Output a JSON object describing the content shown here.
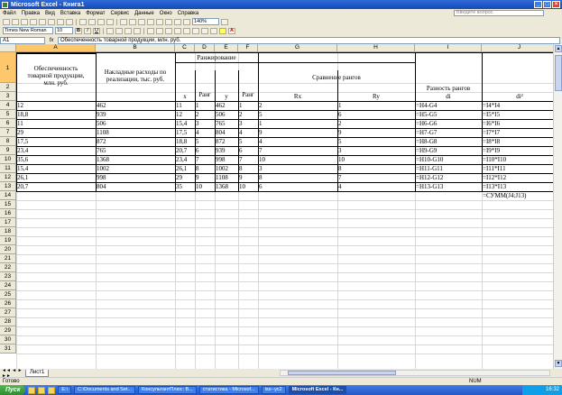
{
  "window": {
    "title": "Microsoft Excel - Книга1"
  },
  "menu": {
    "items": [
      "Файл",
      "Правка",
      "Вид",
      "Вставка",
      "Формат",
      "Сервис",
      "Данные",
      "Окно",
      "Справка"
    ],
    "help_placeholder": "Введите вопрос"
  },
  "toolbar": {
    "zoom": "140%",
    "font_name": "Times New Roman",
    "font_size": "10"
  },
  "formula_bar": {
    "name_box": "A1",
    "fx": "fx",
    "content": "Обеспеченность товарной продукции, млн. руб."
  },
  "grid": {
    "columns": [
      "A",
      "B",
      "C",
      "D",
      "E",
      "F",
      "G",
      "H",
      "I",
      "J"
    ],
    "rows": [
      1,
      2,
      3,
      4,
      5,
      6,
      7,
      8,
      9,
      10,
      11,
      12,
      13,
      14,
      15,
      16,
      17,
      18,
      19,
      20,
      21,
      22,
      23,
      24,
      25,
      26,
      27,
      28,
      29,
      30,
      31
    ],
    "headers": {
      "a": "Обеспеченность товарной продукции, млн. руб.",
      "b": "Накладные расходы по реализации, тыс. руб.",
      "ranking": "Ранжирование",
      "x": "x",
      "rank_x": "Ранг",
      "y": "y",
      "rank_y": "Ранг",
      "compare": "Сравнение рангов",
      "rx": "Rx",
      "ry": "Ry",
      "diff": "Разность рангов",
      "di": "di",
      "di2": "di²"
    },
    "data": [
      [
        "12",
        "462",
        "11",
        "1",
        "462",
        "1",
        "2",
        "1",
        "=H4-G4",
        "=I4*I4"
      ],
      [
        "18,8",
        "939",
        "12",
        "2",
        "506",
        "2",
        "5",
        "6",
        "=H5-G5",
        "=I5*I5"
      ],
      [
        "11",
        "506",
        "15,4",
        "3",
        "765",
        "3",
        "1",
        "2",
        "=H6-G6",
        "=I6*I6"
      ],
      [
        "29",
        "1108",
        "17,5",
        "4",
        "804",
        "4",
        "9",
        "9",
        "=H7-G7",
        "=I7*I7"
      ],
      [
        "17,5",
        "872",
        "18,8",
        "5",
        "872",
        "5",
        "4",
        "5",
        "=H8-G8",
        "=I8*I8"
      ],
      [
        "23,4",
        "765",
        "20,7",
        "6",
        "939",
        "6",
        "7",
        "3",
        "=H9-G9",
        "=I9*I9"
      ],
      [
        "35,6",
        "1368",
        "23,4",
        "7",
        "998",
        "7",
        "10",
        "10",
        "=H10-G10",
        "=I10*I10"
      ],
      [
        "15,4",
        "1002",
        "26,1",
        "8",
        "1002",
        "8",
        "3",
        "8",
        "=H11-G11",
        "=I11*I11"
      ],
      [
        "26,1",
        "998",
        "29",
        "9",
        "1108",
        "9",
        "8",
        "7",
        "=H12-G12",
        "=I12*I12"
      ],
      [
        "20,7",
        "804",
        "35",
        "10",
        "1368",
        "10",
        "6",
        "4",
        "=H13-G13",
        "=I13*I13"
      ]
    ],
    "sum_formula": "=СУММ(J4:J13)"
  },
  "sheet_tab": "Лист1",
  "status": {
    "ready": "Готово",
    "num": "NUM"
  },
  "taskbar": {
    "start": "Пуск",
    "tasks": [
      "E:\\",
      "C:\\Documents and Set...",
      "КонсультантПлюс: В...",
      "статистика - Microsof...",
      "iss--ус2",
      "Microsoft Excel - Кн..."
    ],
    "clock": "16:32"
  }
}
